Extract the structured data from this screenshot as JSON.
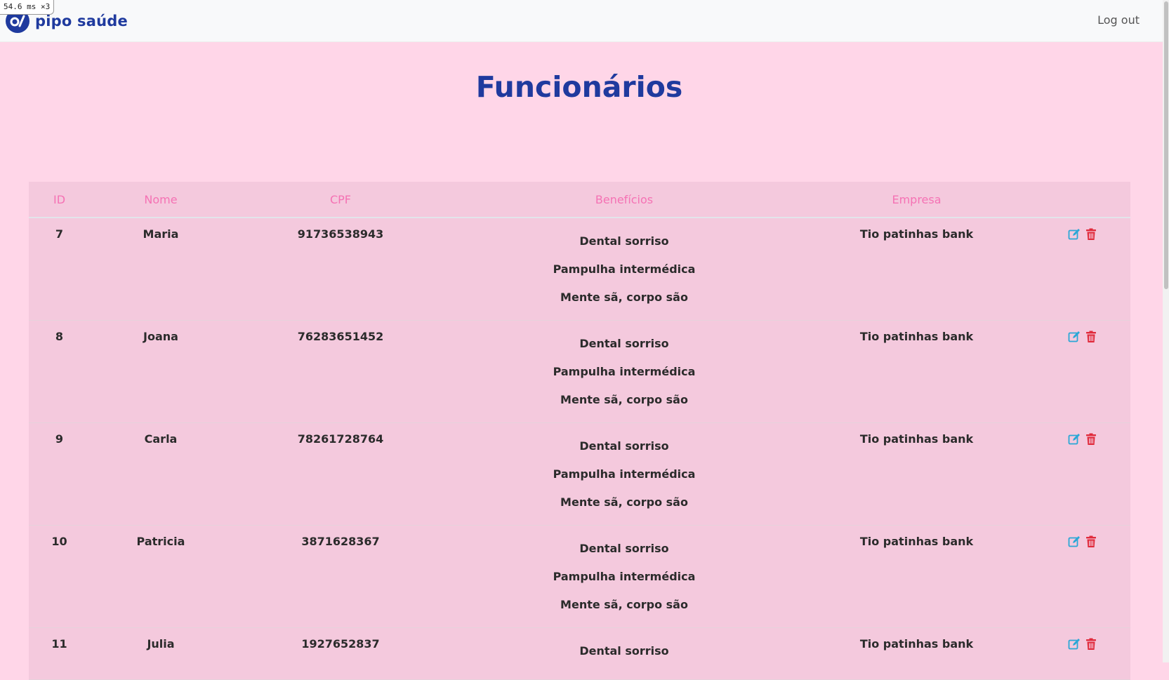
{
  "perf_overlay": "54.6 ms ×3",
  "navbar": {
    "brand": "pipo saúde",
    "logout_label": "Log out"
  },
  "page": {
    "title": "Funcionários"
  },
  "table": {
    "columns": [
      "ID",
      "Nome",
      "CPF",
      "Benefícios",
      "Empresa"
    ],
    "rows": [
      {
        "id": "7",
        "nome": "Maria",
        "cpf": "91736538943",
        "beneficios": [
          "Dental sorriso",
          "Pampulha intermédica",
          "Mente sã, corpo são"
        ],
        "empresa": "Tio patinhas bank"
      },
      {
        "id": "8",
        "nome": "Joana",
        "cpf": "76283651452",
        "beneficios": [
          "Dental sorriso",
          "Pampulha intermédica",
          "Mente sã, corpo são"
        ],
        "empresa": "Tio patinhas bank"
      },
      {
        "id": "9",
        "nome": "Carla",
        "cpf": "78261728764",
        "beneficios": [
          "Dental sorriso",
          "Pampulha intermédica",
          "Mente sã, corpo são"
        ],
        "empresa": "Tio patinhas bank"
      },
      {
        "id": "10",
        "nome": "Patricia",
        "cpf": "3871628367",
        "beneficios": [
          "Dental sorriso",
          "Pampulha intermédica",
          "Mente sã, corpo são"
        ],
        "empresa": "Tio patinhas bank"
      },
      {
        "id": "11",
        "nome": "Julia",
        "cpf": "1927652837",
        "beneficios": [
          "Dental sorriso"
        ],
        "empresa": "Tio patinhas bank"
      }
    ]
  },
  "icons": {
    "edit": "edit-icon",
    "delete": "trash-icon"
  },
  "colors": {
    "brand": "#1f3a9e",
    "header_text": "#f572b4",
    "edit": "#2aa7d6",
    "delete": "#e02a3b",
    "page_bg": "#ffd6e8",
    "table_bg": "#f4c9dd"
  }
}
